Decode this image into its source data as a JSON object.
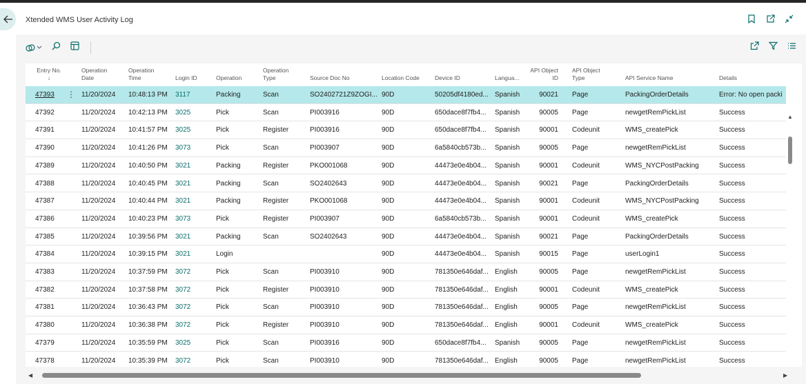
{
  "page": {
    "title": "Xtended WMS User Activity Log"
  },
  "header_icons": [
    "back-arrow-icon",
    "bookmark-icon",
    "open-new-window-icon",
    "collapse-icon"
  ],
  "toolbar": {
    "left_icons": [
      "analysis-icon",
      "search-icon",
      "layout-icon"
    ],
    "right_icons": [
      "share-icon",
      "filter-icon",
      "list-icon"
    ]
  },
  "columns": [
    {
      "line1": "Entry No.",
      "line2": "↓"
    },
    {
      "line1": "Operation",
      "line2": "Date"
    },
    {
      "line1": "Operation",
      "line2": "Time"
    },
    {
      "line1": "",
      "line2": "Login ID"
    },
    {
      "line1": "",
      "line2": "Operation"
    },
    {
      "line1": "Operation",
      "line2": "Type"
    },
    {
      "line1": "",
      "line2": "Source Doc No"
    },
    {
      "line1": "",
      "line2": "Location Code"
    },
    {
      "line1": "",
      "line2": "Device ID"
    },
    {
      "line1": "",
      "line2": "Langua..."
    },
    {
      "line1": "API Object",
      "line2": "ID"
    },
    {
      "line1": "API Object",
      "line2": "Type"
    },
    {
      "line1": "",
      "line2": "API Service Name"
    },
    {
      "line1": "",
      "line2": "Details"
    }
  ],
  "rows": [
    [
      "47393",
      "11/20/2024",
      "10:48:13 PM",
      "3117",
      "Packing",
      "Scan",
      "SO2402721Z9ZOGI...",
      "90D",
      "50205df4180ed...",
      "Spanish",
      "90021",
      "Page",
      "PackingOrderDetails",
      "Error: No open packi"
    ],
    [
      "47392",
      "11/20/2024",
      "10:42:13 PM",
      "3025",
      "Pick",
      "Scan",
      "PI003916",
      "90D",
      "650dace8f7fb4...",
      "Spanish",
      "90005",
      "Page",
      "newgetRemPickList",
      "Success"
    ],
    [
      "47391",
      "11/20/2024",
      "10:41:57 PM",
      "3025",
      "Pick",
      "Register",
      "PI003916",
      "90D",
      "650dace8f7fb4...",
      "Spanish",
      "90001",
      "Codeunit",
      "WMS_createPick",
      "Success"
    ],
    [
      "47390",
      "11/20/2024",
      "10:41:26 PM",
      "3073",
      "Pick",
      "Scan",
      "PI003907",
      "90D",
      "6a5840cb573b...",
      "Spanish",
      "90005",
      "Page",
      "newgetRemPickList",
      "Success"
    ],
    [
      "47389",
      "11/20/2024",
      "10:40:50 PM",
      "3021",
      "Packing",
      "Register",
      "PKO001068",
      "90D",
      "44473e0e4b04...",
      "Spanish",
      "90001",
      "Codeunit",
      "WMS_NYCPostPacking",
      "Success"
    ],
    [
      "47388",
      "11/20/2024",
      "10:40:45 PM",
      "3021",
      "Packing",
      "Scan",
      "SO2402643",
      "90D",
      "44473e0e4b04...",
      "Spanish",
      "90021",
      "Page",
      "PackingOrderDetails",
      "Success"
    ],
    [
      "47387",
      "11/20/2024",
      "10:40:44 PM",
      "3021",
      "Packing",
      "Register",
      "PKO001068",
      "90D",
      "44473e0e4b04...",
      "Spanish",
      "90001",
      "Codeunit",
      "WMS_NYCPostPacking",
      "Success"
    ],
    [
      "47386",
      "11/20/2024",
      "10:40:23 PM",
      "3073",
      "Pick",
      "Register",
      "PI003907",
      "90D",
      "6a5840cb573b...",
      "Spanish",
      "90001",
      "Codeunit",
      "WMS_createPick",
      "Success"
    ],
    [
      "47385",
      "11/20/2024",
      "10:39:56 PM",
      "3021",
      "Packing",
      "Scan",
      "SO2402643",
      "90D",
      "44473e0e4b04...",
      "Spanish",
      "90021",
      "Page",
      "PackingOrderDetails",
      "Success"
    ],
    [
      "47384",
      "11/20/2024",
      "10:39:15 PM",
      "3021",
      "Login",
      "",
      "",
      "90D",
      "44473e0e4b04...",
      "Spanish",
      "90015",
      "Page",
      "userLogin1",
      "Success"
    ],
    [
      "47383",
      "11/20/2024",
      "10:37:59 PM",
      "3072",
      "Pick",
      "Scan",
      "PI003910",
      "90D",
      "781350e646daf...",
      "English",
      "90005",
      "Page",
      "newgetRemPickList",
      "Success"
    ],
    [
      "47382",
      "11/20/2024",
      "10:37:58 PM",
      "3072",
      "Pick",
      "Register",
      "PI003910",
      "90D",
      "781350e646daf...",
      "English",
      "90001",
      "Codeunit",
      "WMS_createPick",
      "Success"
    ],
    [
      "47381",
      "11/20/2024",
      "10:36:43 PM",
      "3072",
      "Pick",
      "Scan",
      "PI003910",
      "90D",
      "781350e646daf...",
      "English",
      "90005",
      "Page",
      "newgetRemPickList",
      "Success"
    ],
    [
      "47380",
      "11/20/2024",
      "10:36:38 PM",
      "3072",
      "Pick",
      "Register",
      "PI003910",
      "90D",
      "781350e646daf...",
      "English",
      "90001",
      "Codeunit",
      "WMS_createPick",
      "Success"
    ],
    [
      "47379",
      "11/20/2024",
      "10:35:59 PM",
      "3025",
      "Pick",
      "Scan",
      "PI003916",
      "90D",
      "650dace8f7fb4...",
      "Spanish",
      "90005",
      "Page",
      "newgetRemPickList",
      "Success"
    ],
    [
      "47378",
      "11/20/2024",
      "10:35:39 PM",
      "3072",
      "Pick",
      "Scan",
      "PI003910",
      "90D",
      "781350e646daf...",
      "English",
      "90005",
      "Page",
      "newgetRemPickList",
      "Success"
    ]
  ],
  "selected_row": 0,
  "colors": {
    "accent": "#0a6e6a",
    "selected_row": "#b5e8ea",
    "back_button": "#dcefee"
  }
}
